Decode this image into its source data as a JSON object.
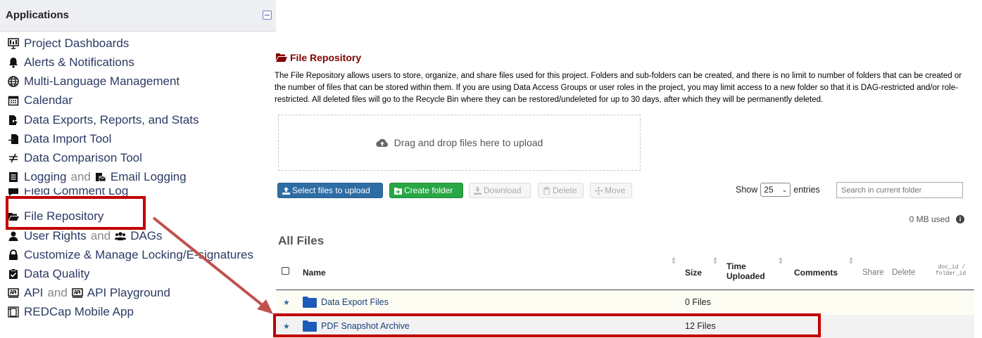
{
  "applications": {
    "title": "Applications",
    "items": [
      {
        "label": "Project Dashboards",
        "icon": "dashboard-icon"
      },
      {
        "label": "Alerts & Notifications",
        "icon": "bell-icon"
      },
      {
        "label": "Multi-Language Management",
        "icon": "globe-icon"
      },
      {
        "label": "Calendar",
        "icon": "calendar-icon"
      },
      {
        "label": "Data Exports, Reports, and Stats",
        "icon": "export-icon"
      },
      {
        "label": "Data Import Tool",
        "icon": "import-icon"
      },
      {
        "label": "Data Comparison Tool",
        "icon": "not-equal-icon"
      },
      {
        "label": "Logging",
        "and": "and",
        "label2": "Email Logging",
        "icon": "list-icon",
        "icon2": "email-log-icon"
      },
      {
        "label": "Field Comment Log",
        "icon": "comment-icon"
      },
      {
        "label": "File Repository",
        "icon": "folder-open-icon"
      },
      {
        "label": "User Rights",
        "and": "and",
        "label2": "DAGs",
        "icon": "user-icon",
        "icon2": "users-icon"
      },
      {
        "label": "Customize & Manage Locking/E-signatures",
        "icon": "lock-icon"
      },
      {
        "label": "Data Quality",
        "icon": "clipboard-check-icon"
      },
      {
        "label": "API",
        "and": "and",
        "label2": "API Playground",
        "icon": "api-icon",
        "icon2": "api-icon"
      },
      {
        "label": "REDCap Mobile App",
        "icon": "mobile-icon"
      }
    ]
  },
  "repository": {
    "title": "File Repository",
    "description": "The File Repository allows users to store, organize, and share files used for this project. Folders and sub-folders can be created, and there is no limit to number of folders that can be created or the number of files that can be stored within them. If you are using Data Access Groups or user roles in the project, you may limit access to a new folder so that it is DAG-restricted and/or role-restricted. All deleted files will go to the Recycle Bin where they can be restored/undeleted for up to 30 days, after which they will be permanently deleted.",
    "dropzone_text": "Drag and drop files here to upload",
    "buttons": {
      "select": "Select files to upload",
      "create": "Create folder",
      "download": "Download",
      "delete": "Delete",
      "move": "Move"
    },
    "show_label": "Show",
    "entries_value": "25",
    "entries_label": "entries",
    "search_placeholder": "Search in current folder",
    "mb_used": "0 MB used",
    "section_title": "All Files",
    "columns": {
      "name": "Name",
      "size": "Size",
      "time": "Time Uploaded",
      "comments": "Comments",
      "share": "Share",
      "delete": "Delete",
      "docid": "doc_id / folder_id"
    },
    "rows": [
      {
        "name": "Data Export Files",
        "size": "0 Files"
      },
      {
        "name": "PDF Snapshot Archive",
        "size": "12 Files"
      }
    ]
  },
  "colors": {
    "highlight": "#c00000",
    "title": "#800000",
    "primary": "#2e6da4",
    "success": "#28a745"
  }
}
